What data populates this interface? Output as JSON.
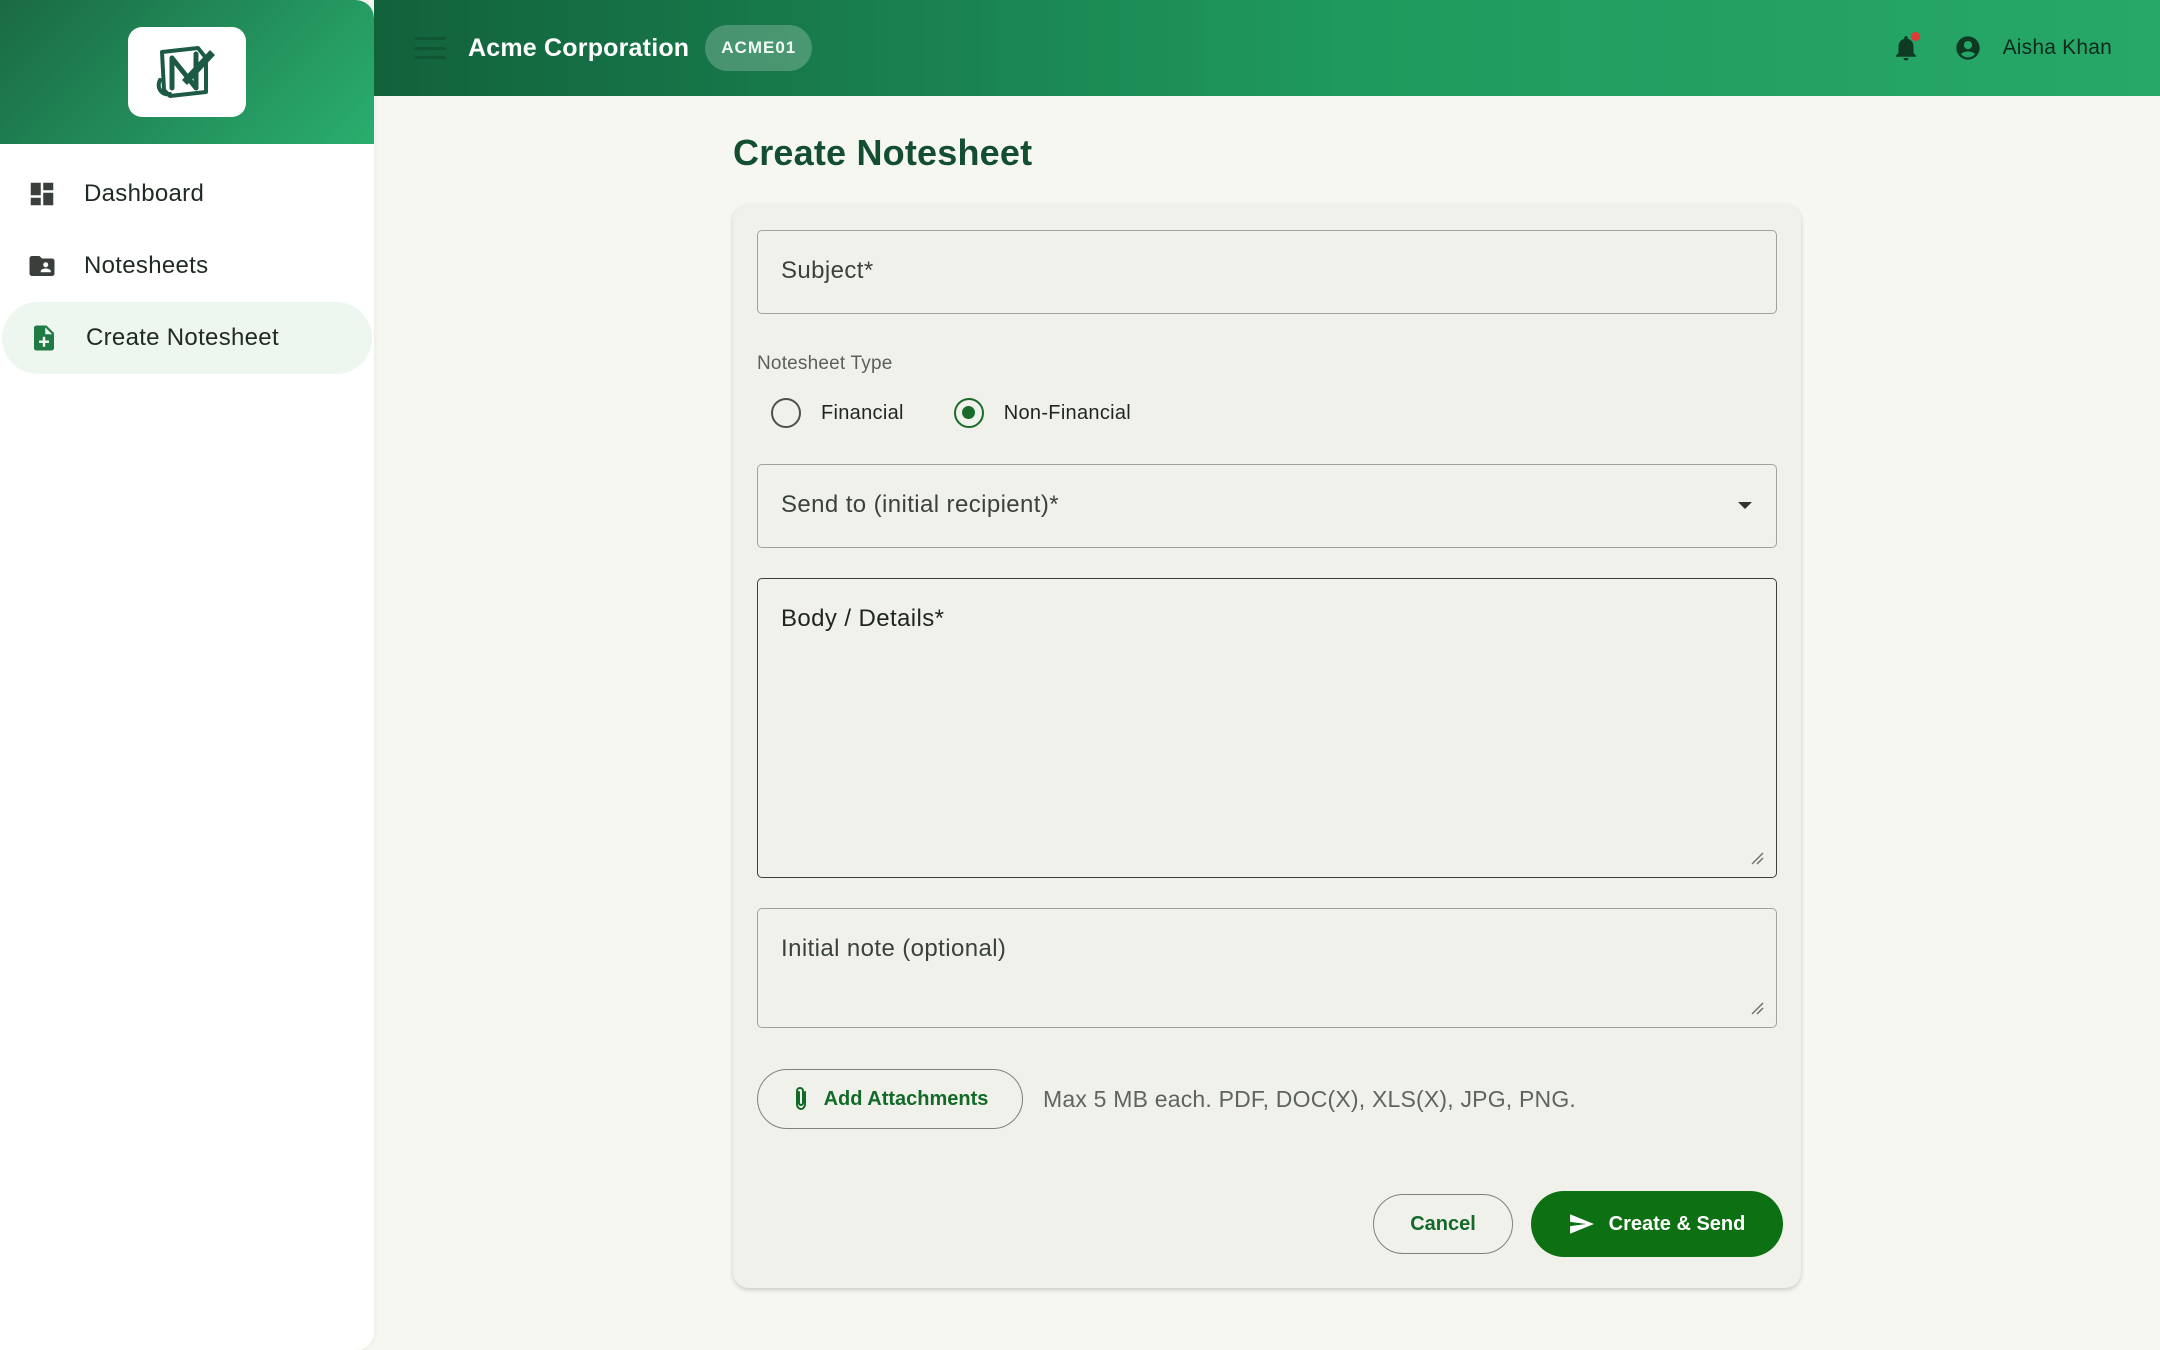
{
  "sidebar": {
    "logo_icon": "notesheet-logo-icon",
    "items": [
      {
        "label": "Dashboard",
        "icon": "dashboard-icon",
        "active": false
      },
      {
        "label": "Notesheets",
        "icon": "folder-user-icon",
        "active": false
      },
      {
        "label": "Create Notesheet",
        "icon": "file-add-icon",
        "active": true
      }
    ]
  },
  "header": {
    "org_name": "Acme Corporation",
    "org_code": "ACME01",
    "user_name": "Aisha Khan",
    "has_notification": true
  },
  "page": {
    "title": "Create Notesheet"
  },
  "form": {
    "subject_label": "Subject*",
    "type_label": "Notesheet Type",
    "type_options": [
      {
        "label": "Financial",
        "checked": false
      },
      {
        "label": "Non-Financial",
        "checked": true
      }
    ],
    "recipient_label": "Send to (initial recipient)*",
    "body_label": "Body / Details*",
    "note_label": "Initial note (optional)",
    "attach_button": "Add Attachments",
    "attach_hint": "Max 5 MB each. PDF, DOC(X), XLS(X), JPG, PNG.",
    "cancel_button": "Cancel",
    "submit_button": "Create & Send"
  },
  "colors": {
    "brand_dark": "#12623c",
    "brand_light": "#27a868",
    "primary_button": "#0d7012",
    "title_green": "#134e31",
    "notification_dot": "#e53935"
  }
}
